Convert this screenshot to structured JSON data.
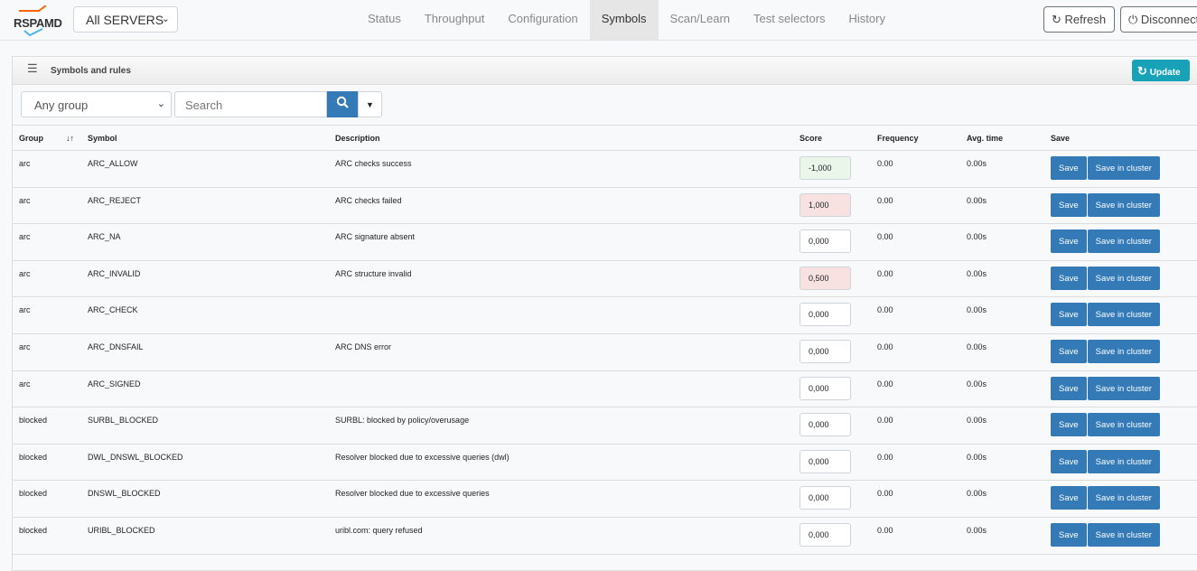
{
  "nav": {
    "logo": "RSPAMD",
    "server": "All SERVERS",
    "tabs": [
      "Status",
      "Throughput",
      "Configuration",
      "Symbols",
      "Scan/Learn",
      "Test selectors",
      "History"
    ],
    "active": "Symbols",
    "refresh": "Refresh",
    "disconnect": "Disconnect"
  },
  "card": {
    "title": "Symbols and rules",
    "update": "Update"
  },
  "filters": {
    "group": "Any group",
    "search_placeholder": "Search"
  },
  "columns": [
    "Group",
    "Symbol",
    "Description",
    "Score",
    "Frequency",
    "Avg. time",
    "Save"
  ],
  "buttons": {
    "save": "Save",
    "cluster": "Save in cluster"
  },
  "rows": [
    {
      "group": "arc",
      "symbol": "ARC_ALLOW",
      "desc": "ARC checks success",
      "score": "-1,000",
      "freq": "0.00",
      "time": "0.00s",
      "kind": "neg"
    },
    {
      "group": "arc",
      "symbol": "ARC_REJECT",
      "desc": "ARC checks failed",
      "score": "1,000",
      "freq": "0.00",
      "time": "0.00s",
      "kind": "pos"
    },
    {
      "group": "arc",
      "symbol": "ARC_NA",
      "desc": "ARC signature absent",
      "score": "0,000",
      "freq": "0.00",
      "time": "0.00s",
      "kind": ""
    },
    {
      "group": "arc",
      "symbol": "ARC_INVALID",
      "desc": "ARC structure invalid",
      "score": "0,500",
      "freq": "0.00",
      "time": "0.00s",
      "kind": "pos"
    },
    {
      "group": "arc",
      "symbol": "ARC_CHECK",
      "desc": "",
      "score": "0,000",
      "freq": "0.00",
      "time": "0.00s",
      "kind": ""
    },
    {
      "group": "arc",
      "symbol": "ARC_DNSFAIL",
      "desc": "ARC DNS error",
      "score": "0,000",
      "freq": "0.00",
      "time": "0.00s",
      "kind": ""
    },
    {
      "group": "arc",
      "symbol": "ARC_SIGNED",
      "desc": "",
      "score": "0,000",
      "freq": "0.00",
      "time": "0.00s",
      "kind": ""
    },
    {
      "group": "blocked",
      "symbol": "SURBL_BLOCKED",
      "desc": "SURBL: blocked by policy/overusage",
      "score": "0,000",
      "freq": "0.00",
      "time": "0.00s",
      "kind": ""
    },
    {
      "group": "blocked",
      "symbol": "DWL_DNSWL_BLOCKED",
      "desc": "Resolver blocked due to excessive queries (dwl)",
      "score": "0,000",
      "freq": "0.00",
      "time": "0.00s",
      "kind": ""
    },
    {
      "group": "blocked",
      "symbol": "DNSWL_BLOCKED",
      "desc": "Resolver blocked due to excessive queries",
      "score": "0,000",
      "freq": "0.00",
      "time": "0.00s",
      "kind": ""
    },
    {
      "group": "blocked",
      "symbol": "URIBL_BLOCKED",
      "desc": "uribl.com: query refused",
      "score": "0,000",
      "freq": "0.00",
      "time": "0.00s",
      "kind": ""
    }
  ]
}
